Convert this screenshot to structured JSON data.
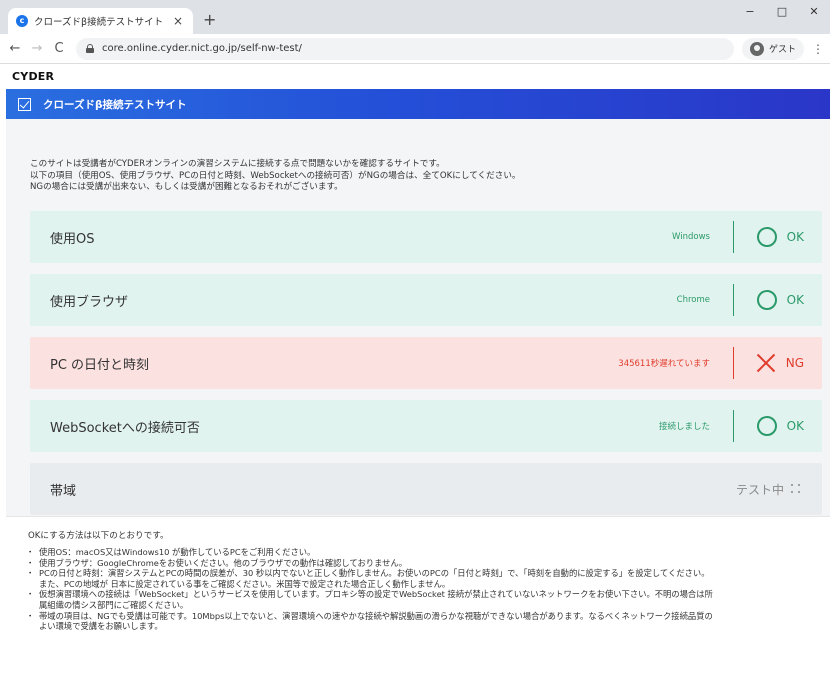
{
  "browser": {
    "tab_title": "クローズドβ接続テストサイト",
    "tab_close": "×",
    "new_tab": "+",
    "url": "core.online.cyder.nict.go.jp/self-nw-test/",
    "profile_label": "ゲスト",
    "back": "←",
    "forward": "→",
    "reload": "C",
    "menu": "⋮",
    "minimize": "−",
    "maximize": "□",
    "close": "✕"
  },
  "brand": "CYDER",
  "site": {
    "title": "クローズドβ接続テストサイト"
  },
  "intro": [
    "このサイトは受講者がCYDERオンラインの演習システムに接続する点で問題ないかを確認するサイトです。",
    "以下の項目（使用OS、使用ブラウザ、PCの日付と時刻、WebSocketへの接続可否）がNGの場合は、全てOKにしてください。",
    "NGの場合には受講が出来ない、もしくは受講が困難となるおそれがございます。"
  ],
  "checks": [
    {
      "label": "使用OS",
      "detail": "Windows",
      "status": "OK",
      "state": "ok"
    },
    {
      "label": "使用ブラウザ",
      "detail": "Chrome",
      "status": "OK",
      "state": "ok"
    },
    {
      "label": "PC の日付と時刻",
      "detail": "345611秒遅れています",
      "status": "NG",
      "state": "ng"
    },
    {
      "label": "WebSocketへの接続可否",
      "detail": "接続しました",
      "status": "OK",
      "state": "ok"
    },
    {
      "label": "帯域",
      "detail": "",
      "status": "テスト中",
      "state": "pending"
    }
  ],
  "notes": {
    "heading": "OKにする方法は以下のとおりです。",
    "items": [
      [
        "使用OS：macOS又はWindows10 が動作しているPCをご利用ください。"
      ],
      [
        "使用ブラウザ：GoogleChromeをお使いください。他のブラウザでの動作は確認しておりません。"
      ],
      [
        "PCの日付と時刻：演習システムとPCの時間の誤差が、30 秒以内でないと正しく動作しません。お使いのPCの「日付と時刻」で、「時刻を自動的に設定する」を設定してください。",
        "また、PCの地域が 日本に設定されている事をご確認ください。米国等で設定された場合正しく動作しません。"
      ],
      [
        "仮想演習環境への接続は「WebSocket」というサービスを使用しています。プロキシ等の設定でWebSocket 接続が禁止されていないネットワークをお使い下さい。不明の場合は所",
        "属組織の情シス部門にご確認ください。"
      ],
      [
        "帯域の項目は、NGでも受講は可能です。10Mbps以上でないと、演習環境への速やかな接続や解説動画の滑らかな視聴ができない場合があります。なるべくネットワーク接続品質の",
        "よい環境で受講をお願いします。"
      ]
    ]
  },
  "colors": {
    "ok": "#2a9a6a",
    "ng": "#e03b2c",
    "header_start": "#2a6fe0",
    "header_end": "#2a36c8"
  }
}
